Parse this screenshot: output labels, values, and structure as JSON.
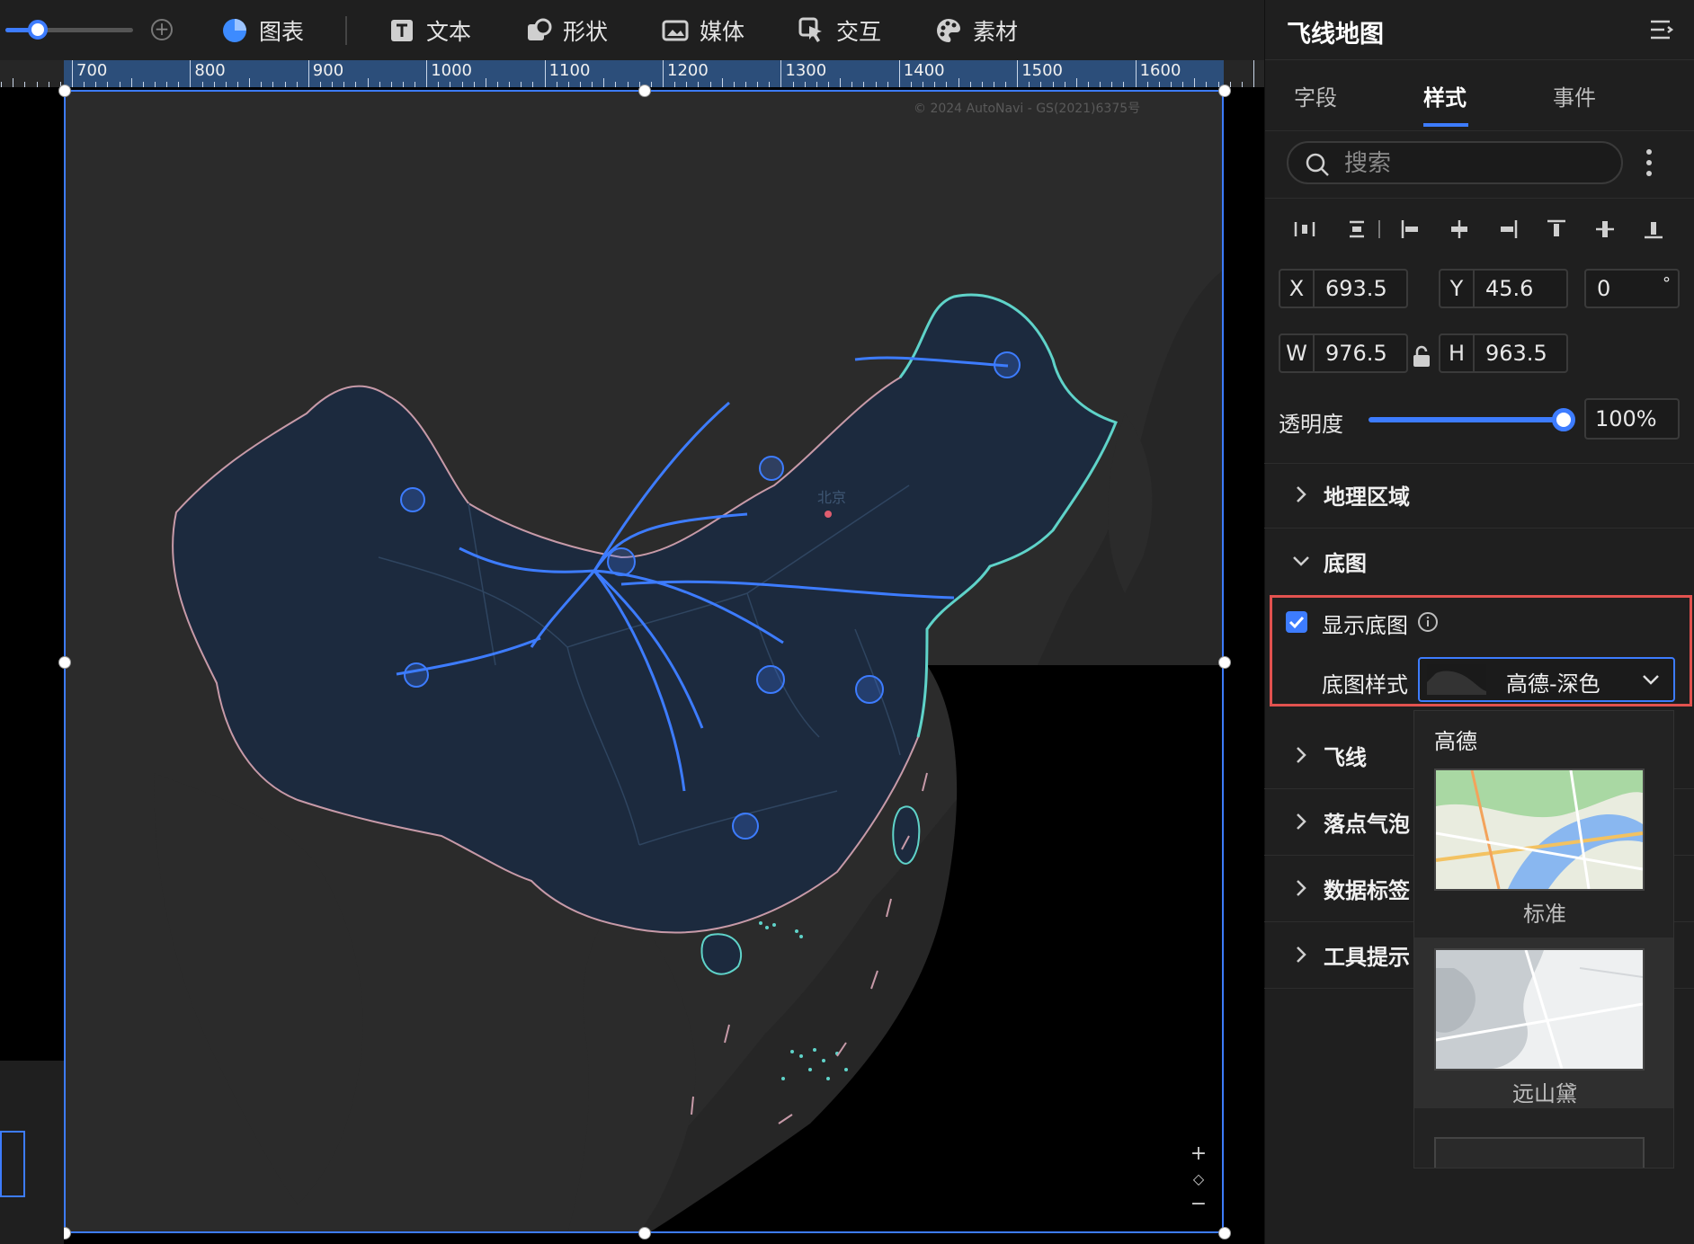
{
  "toolbar": {
    "items": [
      {
        "label": "图表",
        "icon": "pie-chart-icon"
      },
      {
        "label": "文本",
        "icon": "text-icon"
      },
      {
        "label": "形状",
        "icon": "shape-icon"
      },
      {
        "label": "媒体",
        "icon": "media-icon"
      },
      {
        "label": "交互",
        "icon": "interaction-icon"
      },
      {
        "label": "素材",
        "icon": "palette-icon"
      }
    ],
    "zoom_level": 0.25
  },
  "ruler": {
    "labels": [
      "700",
      "800",
      "900",
      "1000",
      "1100",
      "1200",
      "1300",
      "1400",
      "1500",
      "1600"
    ]
  },
  "map": {
    "attribution": "© 2024 AutoNavi - GS(2021)6375号",
    "city_label": "北京",
    "controls": [
      "+",
      "◇",
      "−"
    ]
  },
  "panel": {
    "title": "飞线地图",
    "tabs": [
      {
        "label": "字段",
        "active": false
      },
      {
        "label": "样式",
        "active": true
      },
      {
        "label": "事件",
        "active": false
      }
    ],
    "search_placeholder": "搜索",
    "position": {
      "x_label": "X",
      "x_value": "693.5",
      "y_label": "Y",
      "y_value": "45.6",
      "rotation_value": "0",
      "rotation_unit": "°",
      "w_label": "W",
      "w_value": "976.5",
      "h_label": "H",
      "h_value": "963.5"
    },
    "opacity": {
      "label": "透明度",
      "value": "100%",
      "fraction": 1.0
    },
    "sections": {
      "geo_region": "地理区域",
      "basemap": "底图",
      "flylines": "飞线",
      "bubbles": "落点气泡",
      "data_labels": "数据标签",
      "tooltip": "工具提示"
    },
    "basemap": {
      "show_label": "显示底图",
      "show_checked": true,
      "style_label": "底图样式",
      "style_value": "高德-深色"
    },
    "dropdown": {
      "group": "高德",
      "options": [
        {
          "name": "标准"
        },
        {
          "name": "远山黛"
        }
      ]
    }
  },
  "colors": {
    "accent": "#3d7cff",
    "highlight_border": "#e2524f",
    "map_land": "#1c2a3e",
    "china_border": "#5fd3c9"
  }
}
